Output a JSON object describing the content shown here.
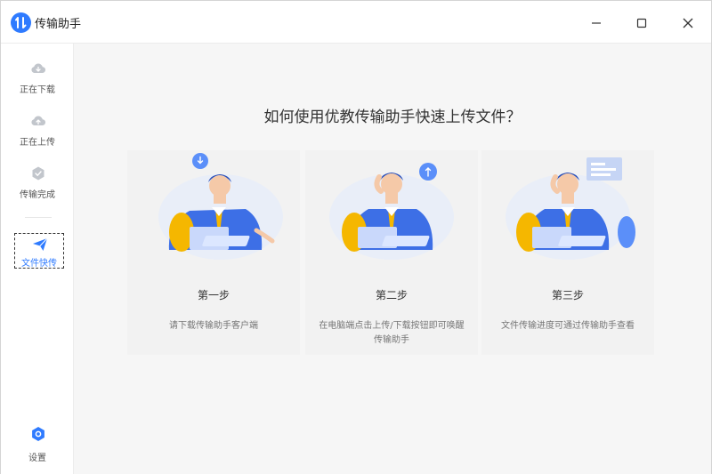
{
  "app": {
    "title": "传输助手",
    "colors": {
      "accent": "#2f7bff",
      "sidebar_icon": "#c2c6cc",
      "background": "#f6f6f6"
    }
  },
  "window_controls": {
    "minimize_icon": "minimize-icon",
    "maximize_icon": "maximize-icon",
    "close_icon": "close-icon"
  },
  "sidebar": {
    "items": [
      {
        "label": "正在下载",
        "icon": "cloud-download-icon"
      },
      {
        "label": "正在上传",
        "icon": "cloud-upload-icon"
      },
      {
        "label": "传输完成",
        "icon": "check-shield-icon"
      },
      {
        "label": "文件快传",
        "icon": "paper-plane-icon"
      }
    ],
    "settings": {
      "label": "设置",
      "icon": "gear-icon"
    }
  },
  "main": {
    "title": "如何使用优教传输助手快速上传文件？",
    "steps": [
      {
        "title": "第一步",
        "desc": "请下载传输助手客户端",
        "icon": "download-badge-icon"
      },
      {
        "title": "第二步",
        "desc": "在电脑端点击上传/下载按钮即可唤醒传输助手",
        "icon": "upload-badge-icon"
      },
      {
        "title": "第三步",
        "desc": "文件传输进度可通过传输助手查看",
        "icon": "progress-panel-icon"
      }
    ]
  }
}
